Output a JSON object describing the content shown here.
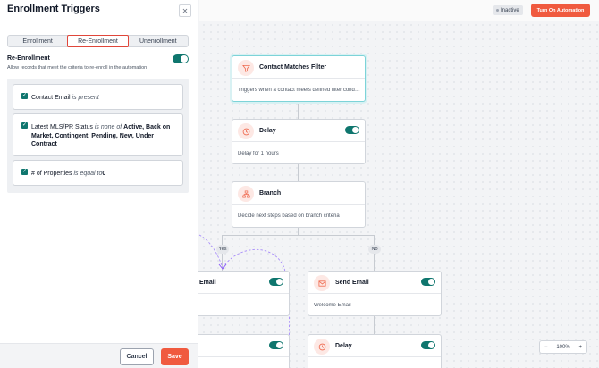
{
  "header": {
    "status": "Inactive",
    "turn_on_label": "Turn On Automation"
  },
  "panel": {
    "title": "Enrollment Triggers",
    "close_icon": "close-icon",
    "tabs": [
      {
        "label": "Enrollment",
        "active": false
      },
      {
        "label": "Re-Enrollment",
        "active": true
      },
      {
        "label": "Unenrollment",
        "active": false
      }
    ],
    "reenroll": {
      "label": "Re-Enrollment",
      "help": "Allow records that meet the criteria to re-enroll in the automation",
      "enabled": true
    },
    "criteria": [
      {
        "field": "Contact Email",
        "operator": "is present",
        "value": ""
      },
      {
        "field": "Latest MLS/PR Status",
        "operator": "is none of",
        "value": "Active, Back on Market, Contingent, Pending, New, Under Contract"
      },
      {
        "field": "# of Properties",
        "operator": "is equal to",
        "value": "0"
      }
    ],
    "cancel_label": "Cancel",
    "save_label": "Save"
  },
  "workflow": {
    "nodes": [
      {
        "title": "Contact Matches Filter",
        "body": "Triggers when a contact meets defined filter conditions",
        "icon": "filter-icon"
      },
      {
        "title": "Delay",
        "body": "Delay for 1 hours",
        "icon": "clock-icon",
        "enabled": true
      },
      {
        "title": "Branch",
        "body": "Decide next steps based on branch criteria",
        "icon": "branch-icon"
      },
      {
        "title": "Email",
        "body": "",
        "icon": "mail-icon",
        "enabled": true
      },
      {
        "title": "Send Email",
        "body": "Welcome Email",
        "icon": "mail-icon",
        "enabled": true
      },
      {
        "title": "",
        "body": "",
        "icon": "",
        "enabled": true
      },
      {
        "title": "Delay",
        "body": "",
        "icon": "clock-icon",
        "enabled": true
      }
    ],
    "branch_yes": "Yes",
    "branch_no": "No"
  },
  "zoom": {
    "level": "100%",
    "minus": "−",
    "plus": "+"
  },
  "colors": {
    "accent": "#f05a3f",
    "toggle": "#0f766e",
    "active_tab_border": "#e0463a"
  }
}
